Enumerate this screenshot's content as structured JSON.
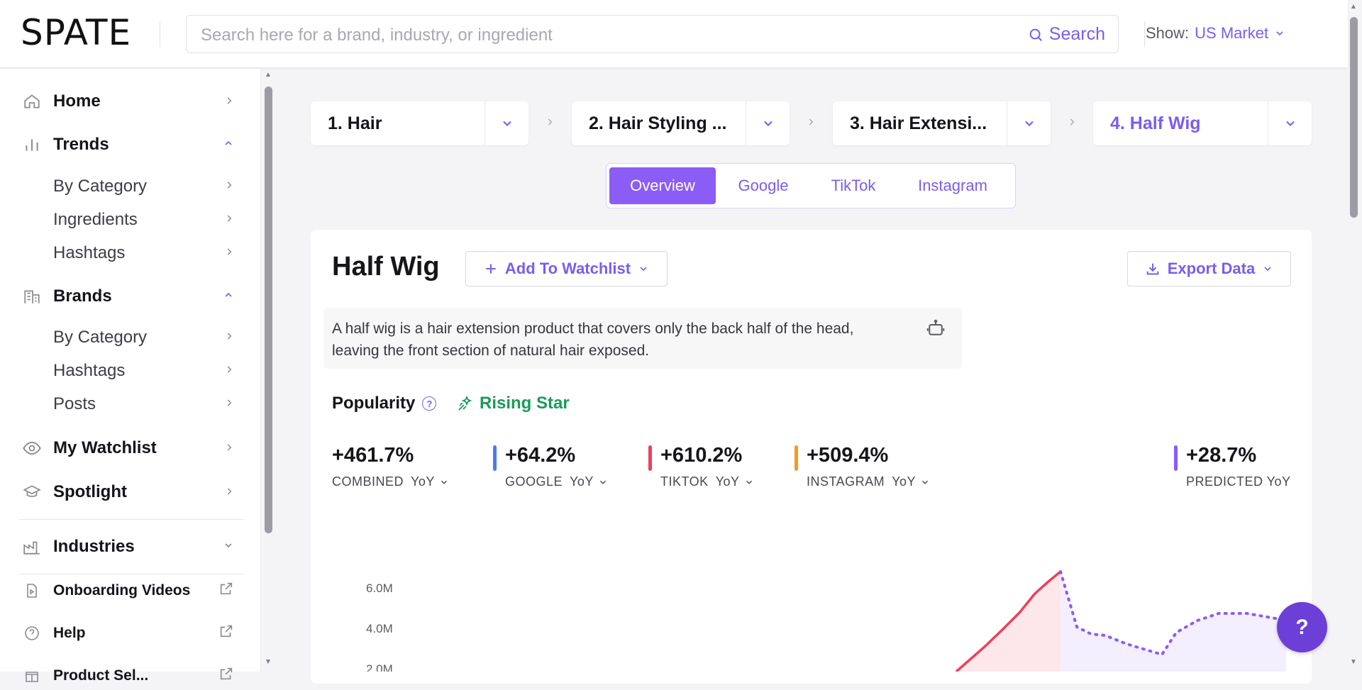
{
  "brand": {
    "logo": "SPATE"
  },
  "search": {
    "placeholder": "Search here for a brand, industry, or ingredient",
    "button_label": "Search"
  },
  "market": {
    "label": "Show:",
    "value": "US Market"
  },
  "sidebar": {
    "home": "Home",
    "trends": "Trends",
    "trends_items": [
      "By Category",
      "Ingredients",
      "Hashtags"
    ],
    "brands": "Brands",
    "brands_items": [
      "By Category",
      "Hashtags",
      "Posts"
    ],
    "watchlist": "My Watchlist",
    "spotlight": "Spotlight",
    "industries": "Industries",
    "onboarding": "Onboarding Videos",
    "help": "Help",
    "partial": "Product Sel..."
  },
  "breadcrumbs": [
    "1. Hair",
    "2. Hair Styling ...",
    "3. Hair Extensi...",
    "4. Half Wig"
  ],
  "tabs": [
    "Overview",
    "Google",
    "TikTok",
    "Instagram"
  ],
  "active_tab": "Overview",
  "product": {
    "title": "Half Wig",
    "watchlist_label": "Add To Watchlist",
    "export_label": "Export Data",
    "description": "A half wig is a hair extension product that covers only the back half of the head, leaving the front section of natural hair exposed."
  },
  "popularity": {
    "label": "Popularity",
    "status": "Rising Star"
  },
  "metrics": [
    {
      "value": "+461.7%",
      "label": "COMBINED",
      "period": "YoY",
      "color": ""
    },
    {
      "value": "+64.2%",
      "label": "GOOGLE",
      "period": "YoY",
      "color": "#4a7cf0"
    },
    {
      "value": "+610.2%",
      "label": "TIKTOK",
      "period": "YoY",
      "color": "#ee3f5c"
    },
    {
      "value": "+509.4%",
      "label": "INSTAGRAM",
      "period": "YoY",
      "color": "#f59a23"
    }
  ],
  "predicted": {
    "value": "+28.7%",
    "label": "PREDICTED YoY",
    "color": "#8b5cf6"
  },
  "chart_data": {
    "type": "area",
    "yticks": [
      "6.0M",
      "4.0M",
      "2.0M"
    ],
    "series": [
      {
        "color": "#ee3f5c"
      },
      {
        "color": "#8b5cf6"
      }
    ]
  },
  "fab": {
    "label": "?"
  }
}
